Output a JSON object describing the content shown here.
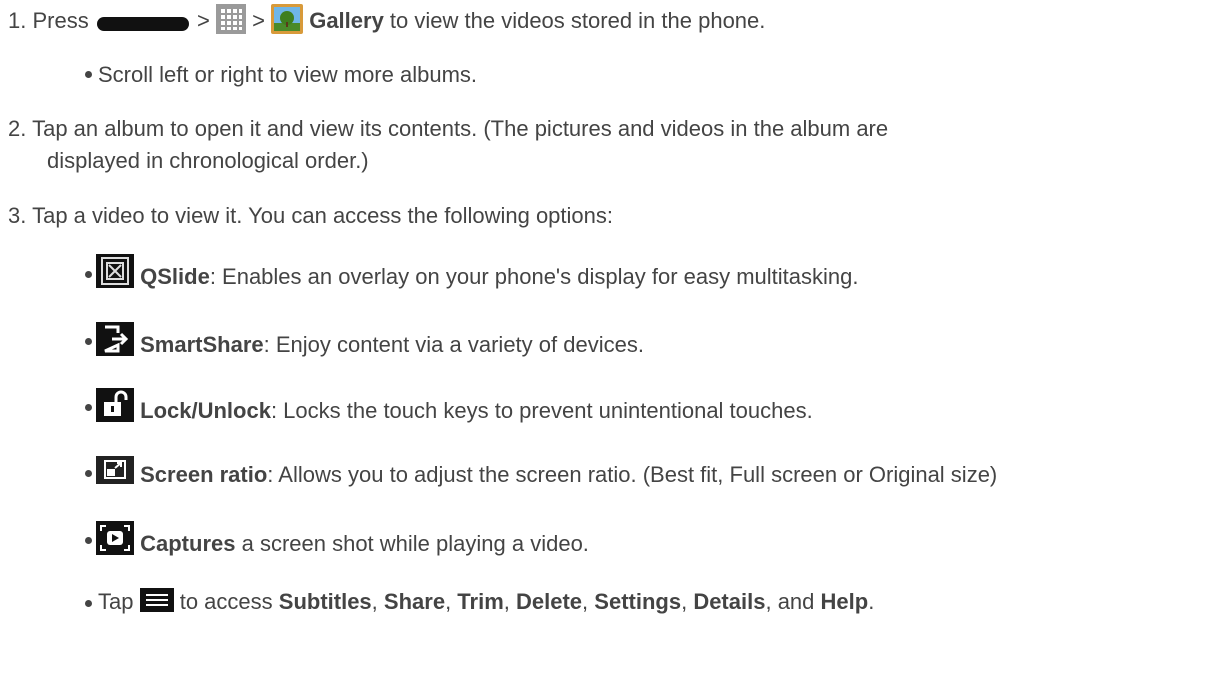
{
  "step1": {
    "number": "1.",
    "press": "Press",
    "sep1": ">",
    "sep2": ">",
    "gallery": "Gallery",
    "rest": " to view the videos stored in the phone."
  },
  "step1_bullet": "Scroll left or right to view more albums.",
  "step2": {
    "number": "2.",
    "line1": "Tap an album to open it and view its contents. (The pictures and videos in the album are",
    "line2": "displayed in chronological order.)"
  },
  "step3": {
    "number": "3.",
    "text": "Tap a video to view it. You can access the following options:"
  },
  "options": [
    {
      "label": "QSlide",
      "desc": ": Enables an overlay on your phone's display for easy multitasking."
    },
    {
      "label": "SmartShare",
      "desc": ": Enjoy content via a variety of devices."
    },
    {
      "label": "Lock/Unlock",
      "desc": ": Locks the touch keys to prevent unintentional touches."
    },
    {
      "label": "Screen ratio",
      "desc": ": Allows you to adjust the screen ratio. (Best fit, Full screen or Original size)"
    },
    {
      "label": "Captures",
      "desc": " a screen shot while playing a video."
    }
  ],
  "menu_line": {
    "tap": "Tap",
    "to_access": " to access ",
    "items": [
      "Subtitles",
      "Share",
      "Trim",
      "Delete",
      "Settings",
      "Details"
    ],
    "comma": ", ",
    "and": ", and ",
    "help": "Help",
    "period": "."
  }
}
